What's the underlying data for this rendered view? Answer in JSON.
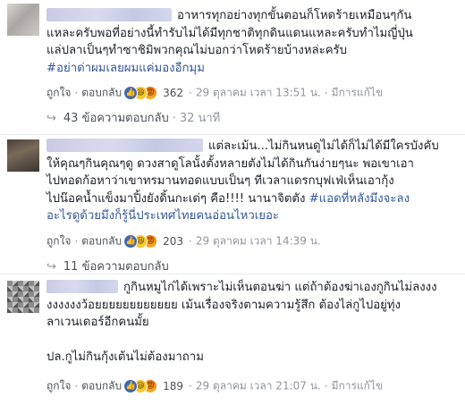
{
  "comments": [
    {
      "lines": [
        "อาหารทุกอย่างทุกขั้นตอนก็โหดร้ายเหมือนๆกัน",
        "แหละครับพอที่อย่างนี้ทำรับไม่ได้มีทุกชาติทุกดินแดนแหละครับทำไมญี่ปุ่น",
        "แล่ปลาเป็นๆทำซาชิมิพวกคุณไม่บอกว่าโหดร้ายบ้างหล่ะครับ"
      ],
      "hashtag": "#อย่าด่าผมเลยผมแค่มองอีกมุม",
      "actions": {
        "like": "ถูกใจ",
        "reply": "ตอบกลับ",
        "reaction_count": "362",
        "date": "29 ตุลาคม เวลา 13:51 น.",
        "edited": "มีการแก้ไข"
      },
      "replies": {
        "label": "43 ข้อความตอบกลับ",
        "time": "32 นาที"
      }
    },
    {
      "lines": [
        "แต่ละเม้น...ไม่กินหนดูไม่ได้ก็ไม่ได้มีใครบังคับ",
        "ให้คุณๆกินคุณๆดู ดวงสาดูโลนั้งตั้งหลายตังไม่ได้กินกันง่ายๆนะ พอเขาเอา",
        "ไปทอดก้อหาว่าเขาทรมานทอดแบบเป็นๆ ทีเวลาแดรกบุฟเฟ่เห็นเอากุ้ง",
        "ไปน๊อคน้ำแข็งมาปิ้งยังดิ้นกะเด่ๆ คือ!!!! นานาจิตตัง "
      ],
      "hashtag_inline": "#แอดที่หลังมึงจะลง",
      "line_after": "อะไรดูด้วยมึงก็รู้นี่ประเทศไทยคนอ่อนไหวเยอะ",
      "actions": {
        "like": "ถูกใจ",
        "reply": "ตอบกลับ",
        "reaction_count": "203",
        "date": "29 ตุลาคม เวลา 14:39 น."
      },
      "replies": {
        "label": "11 ข้อความตอบกลับ"
      }
    },
    {
      "lines": [
        "กูกินหมูไก่ได้เพราะไม่เห็นตอนฆ่า แต่ถ้าต้องฆ่าเองกูกินไม่ลงงง",
        "งงงงงงว้อยยยยยยยยยยยย เม้นเรื่องจริงตามความรู้สึก ต้องไล่กูไปอยู่ทุ่ง",
        "ลาเวนเดอร์อีกคนมั้ย",
        "",
        "ปล.กูไม่กินกุ้งเต้นไม่ต้องมาถาม"
      ],
      "actions": {
        "like": "ถูกใจ",
        "reply": "ตอบกลับ",
        "reaction_count": "189",
        "date": "29 ตุลาคม เวลา 21:07 น.",
        "edited": "มีการแก้ไข"
      }
    }
  ],
  "icons": {
    "reply": "reply-arrow-icon",
    "like": "like-icon",
    "haha": "haha-icon",
    "angry": "angry-icon"
  },
  "colors": {
    "hashtag": "#365899",
    "meta": "#90949c",
    "link": "#4b4f56",
    "like_blue": "#4267b2"
  }
}
